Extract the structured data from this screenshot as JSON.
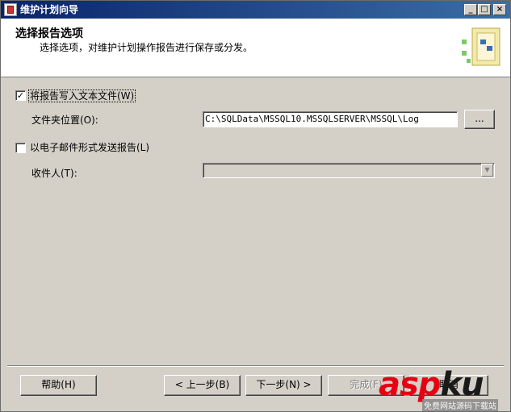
{
  "window": {
    "title": "维护计划向导",
    "controls": {
      "minimize": "_",
      "maximize": "□",
      "close": "×"
    }
  },
  "header": {
    "title": "选择报告选项",
    "subtitle": "选择选项，对维护计划操作报告进行保存或分发。",
    "graphic_icon": "wizard-graphic-icon"
  },
  "options": {
    "write_to_file": {
      "label": "将报告写入文本文件(W)",
      "checked": true,
      "mark": "✓"
    },
    "folder": {
      "label": "文件夹位置(O):",
      "value": "C:\\SQLData\\MSSQL10.MSSQLSERVER\\MSSQL\\Log",
      "browse_label": "..."
    },
    "email": {
      "label": "以电子邮件形式发送报告(L)",
      "checked": false
    },
    "recipient": {
      "label": "收件人(T):",
      "value": ""
    }
  },
  "buttons": {
    "help": "帮助(H)",
    "back": "< 上一步(B)",
    "next": "下一步(N) >",
    "finish": "完成(F)",
    "cancel": "取消"
  },
  "watermark": {
    "text": "aspku",
    "caption": "免费网站源码下载站",
    "colors": {
      "asp": "#e60012",
      "ku": "#1a1a1a"
    }
  }
}
